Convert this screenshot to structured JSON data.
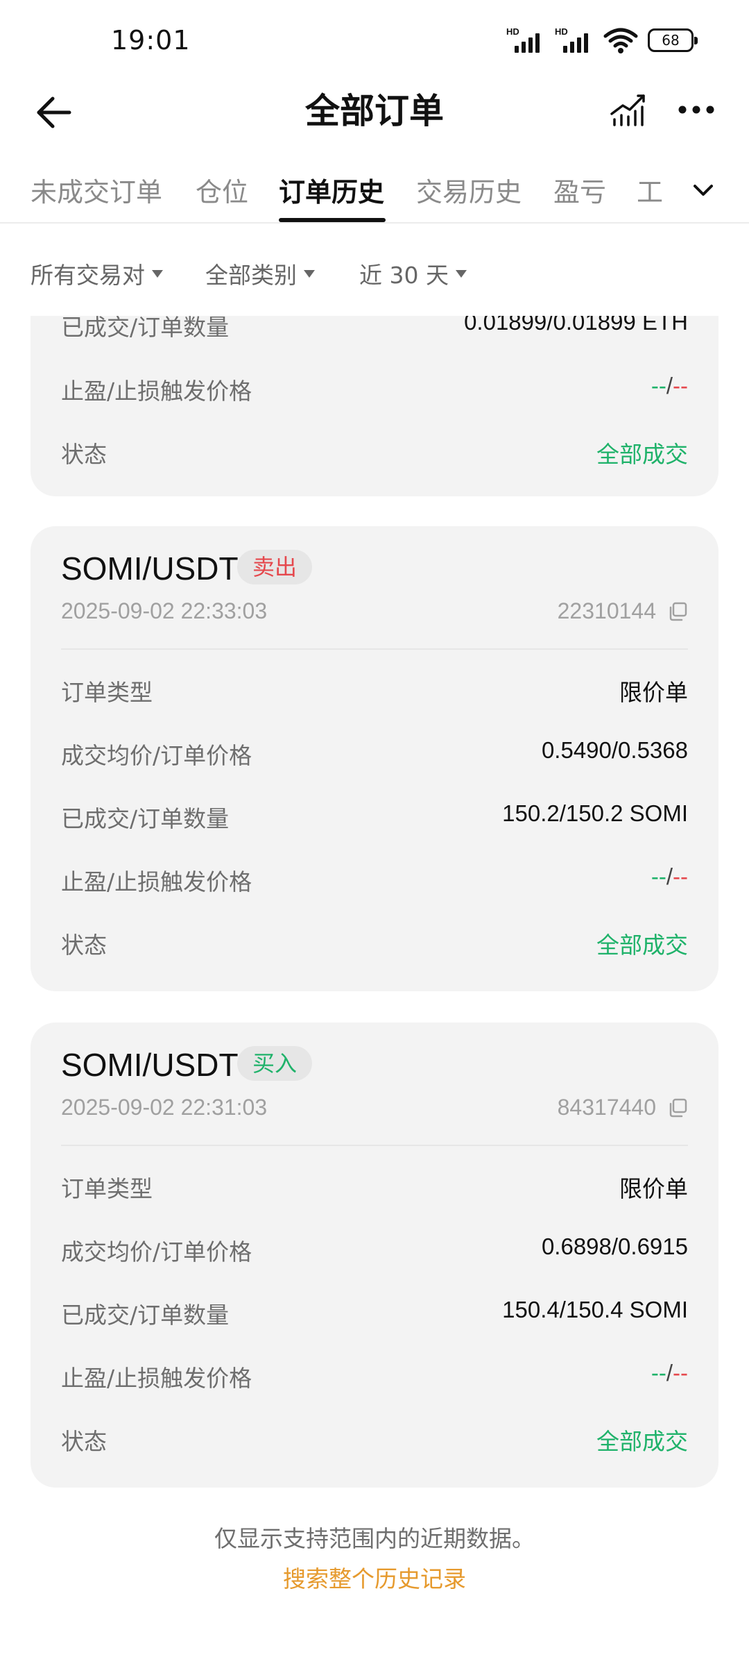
{
  "status_bar": {
    "time": "19:01",
    "sim1_label": "HD",
    "sim2_label": "HD",
    "battery": "68",
    "icons": [
      "signal-icon",
      "signal-icon",
      "wifi-icon",
      "battery-icon"
    ]
  },
  "header": {
    "title": "全部订单",
    "icons": [
      "back-arrow-icon",
      "chart-icon",
      "more-icon"
    ]
  },
  "tabs": {
    "items": [
      "未成交订单",
      "仓位",
      "订单历史",
      "交易历史",
      "盈亏",
      "工"
    ],
    "active": "订单历史"
  },
  "filters": {
    "pair": "所有交易对",
    "category": "全部类别",
    "period": "近 30 天"
  },
  "labels": {
    "order_type": "订单类型",
    "avg_price": "成交均价/订单价格",
    "filled_qty": "已成交/订单数量",
    "tp_sl": "止盈/止损触发价格",
    "status": "状态"
  },
  "partial_card": {
    "filled_qty": "0.01899/0.01899 ETH",
    "tp": "--",
    "sep": "/",
    "sl": "--",
    "status": "全部成交"
  },
  "orders": [
    {
      "pair": "SOMI/USDT",
      "side": "卖出",
      "time": "2025-09-02 22:33:03",
      "order_id": "22310144",
      "order_type": "限价单",
      "avg_price": "0.5490/0.5368",
      "filled_qty": "150.2/150.2 SOMI",
      "tp": "--",
      "sep": "/",
      "sl": "--",
      "status": "全部成交"
    },
    {
      "pair": "SOMI/USDT",
      "side": "买入",
      "time": "2025-09-02 22:31:03",
      "order_id": "84317440",
      "order_type": "限价单",
      "avg_price": "0.6898/0.6915",
      "filled_qty": "150.4/150.4 SOMI",
      "tp": "--",
      "sep": "/",
      "sl": "--",
      "status": "全部成交"
    }
  ],
  "footer": {
    "note": "仅显示支持范围内的近期数据。",
    "link": "搜索整个历史记录"
  },
  "colors": {
    "buy": "#1fb26a",
    "sell": "#e5484d",
    "link": "#e69a2e",
    "card_bg": "#f3f3f3"
  }
}
